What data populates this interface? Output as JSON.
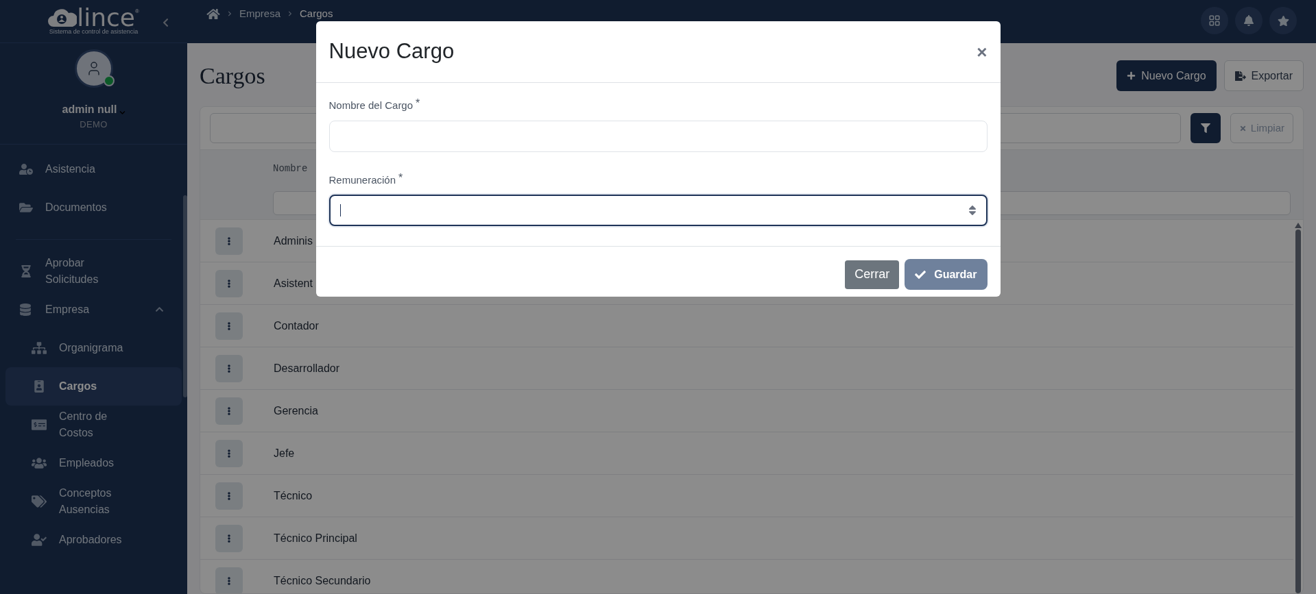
{
  "sidebar": {
    "logo": {
      "name": "lince",
      "mark": "®",
      "tagline": "Sistema de control de asistencia"
    },
    "user": {
      "name": "admin null",
      "org": "DEMO",
      "online": true
    },
    "items": [
      {
        "kind": "item",
        "label": "Asistencia",
        "selected": false
      },
      {
        "kind": "item",
        "label": "Documentos",
        "selected": false
      },
      {
        "kind": "divider"
      },
      {
        "kind": "item",
        "label": "Aprobar Solicitudes",
        "selected": false
      },
      {
        "kind": "group",
        "label": "Empresa",
        "expanded": true,
        "children": [
          {
            "label": "Organigrama",
            "selected": false
          },
          {
            "label": "Cargos",
            "selected": true
          },
          {
            "label": "Centro de Costos",
            "selected": false
          },
          {
            "label": "Empleados",
            "selected": false
          },
          {
            "label": "Conceptos Ausencias",
            "selected": false
          },
          {
            "label": "Aprobadores",
            "selected": false
          }
        ]
      }
    ]
  },
  "topbar": {
    "breadcrumb": [
      "Empresa",
      "Cargos"
    ]
  },
  "page": {
    "title": "Cargos",
    "buttons": [
      {
        "kind": "primary",
        "label": "Nuevo Cargo"
      },
      {
        "kind": "outline",
        "label": "Exportar"
      }
    ],
    "clear_button": "Limpiar",
    "table": {
      "columns": [
        "Nombre"
      ],
      "rows": [
        "Adminis",
        "Asistent",
        "Contador",
        "Desarrollador",
        "Gerencia",
        "Jefe",
        "Técnico",
        "Técnico Principal",
        "Técnico Secundario"
      ]
    }
  },
  "modal": {
    "title": "Nuevo Cargo",
    "close": "×",
    "fields": [
      {
        "kind": "text",
        "label": "Nombre del Cargo",
        "required_mark": "*",
        "focused": false
      },
      {
        "kind": "select",
        "label": "Remuneración",
        "required_mark": "*",
        "focused": true
      }
    ],
    "buttons": [
      {
        "kind": "secondary",
        "label": "Cerrar",
        "disabled": false
      },
      {
        "kind": "primary",
        "label": "Guardar",
        "disabled": true
      }
    ]
  }
}
